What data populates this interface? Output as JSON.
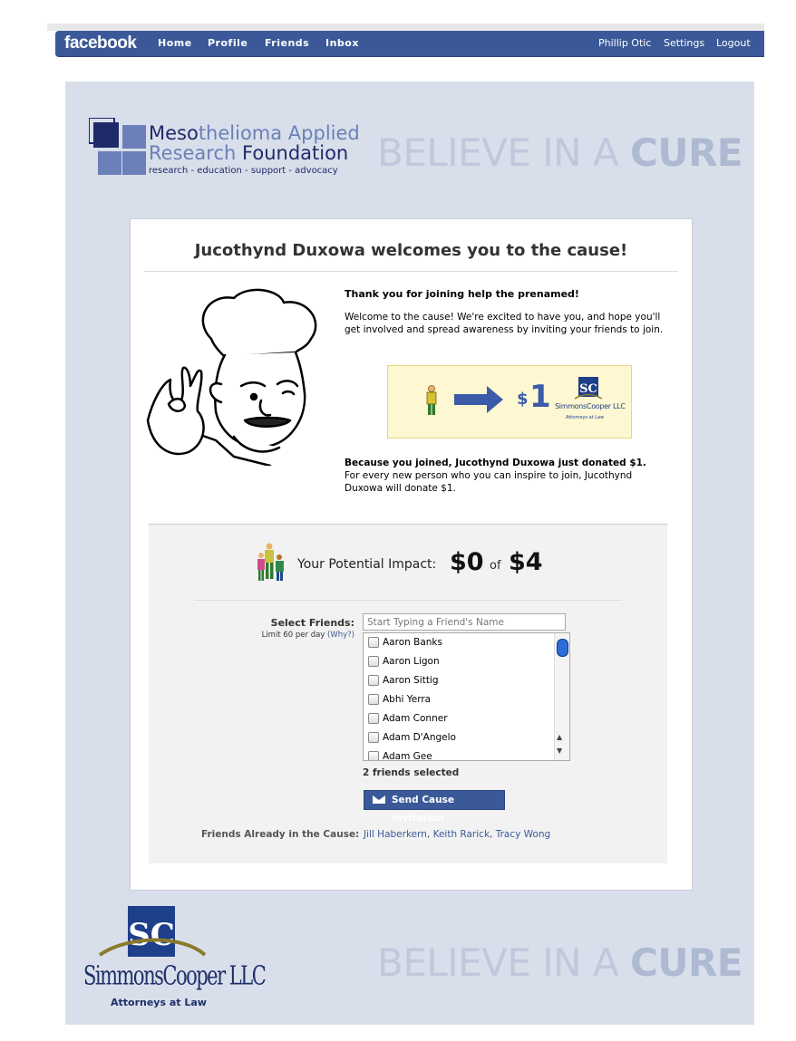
{
  "fbbar": {
    "logo": "facebook",
    "nav": [
      "Home",
      "Profile",
      "Friends",
      "Inbox"
    ],
    "user": "Phillip Otic",
    "settings": "Settings",
    "logout": "Logout"
  },
  "banner": {
    "org_line1_a": "Meso",
    "org_line1_b": "thelioma Applied",
    "org_line2_a": "Research ",
    "org_line2_b": "Foundation",
    "org_tagline": "research - education - support - advocacy",
    "believe_prefix": "BELIEVE IN A ",
    "believe_strong": "CURE"
  },
  "card": {
    "title": "Jucothynd Duxowa welcomes you to the cause!",
    "thanks": "Thank you for joining help the prenamed!",
    "welcome": "Welcome to the cause! We're excited to have you, and hope you'll get involved and spread awareness by inviting your friends to join.",
    "donation": {
      "currency": "$",
      "amount": "1",
      "sponsor": "SimmonsCooper LLC",
      "sponsor_sub": "Attorneys at Law"
    },
    "because_bold": "Because you joined, Jucothynd Duxowa just donated $1.",
    "because_rest": "For every new person who you can inspire to join, Jucothynd Duxowa will donate $1."
  },
  "impact": {
    "label": "Your Potential Impact:",
    "current": "$0",
    "of": "of",
    "max": "$4"
  },
  "select": {
    "label": "Select Friends:",
    "limit": "Limit 60 per day",
    "why": "(Why?)",
    "placeholder": "Start Typing a Friend's Name",
    "friends": [
      "Aaron Banks",
      "Aaron Ligon",
      "Aaron Sittig",
      "Abhi Yerra",
      "Adam Conner",
      "Adam D'Angelo",
      "Adam Gee"
    ],
    "selected_text": "2 friends selected",
    "send_label": "Send Cause Invitation"
  },
  "already": {
    "label": "Friends Already in the Cause:",
    "names": "Jill Haberkern, Keith Rarick, Tracy Wong"
  },
  "footer": {
    "sponsor_name": "SimmonsCooper LLC",
    "sponsor_sub": "Attorneys at Law",
    "believe_prefix": "BELIEVE IN A ",
    "believe_strong": "CURE"
  },
  "colors": {
    "fb_blue": "#3b5998",
    "panel": "#d8dfea",
    "donation_bg": "#fdf8d2",
    "believe": "#bfc8dc"
  }
}
